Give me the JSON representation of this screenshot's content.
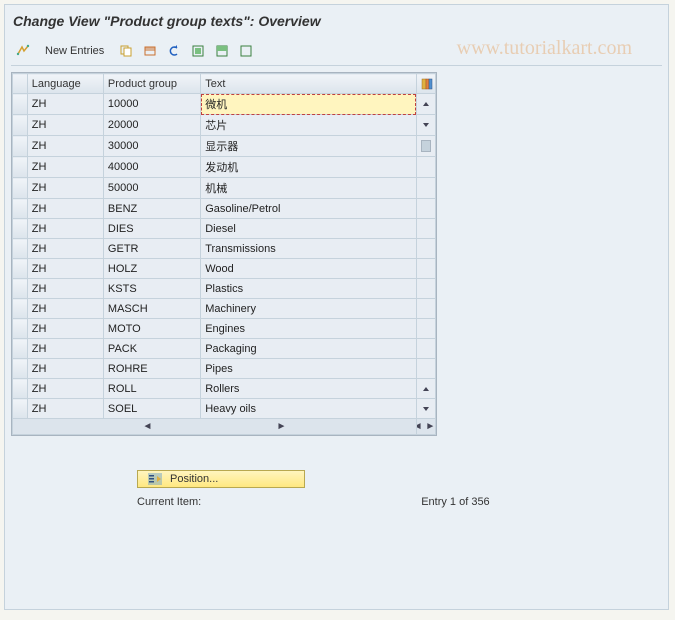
{
  "title": "Change View \"Product group texts\": Overview",
  "toolbar": {
    "new_entries_label": "New Entries"
  },
  "watermark": "www.tutorialkart.com",
  "columns": {
    "language": "Language",
    "product_group": "Product group",
    "text": "Text"
  },
  "rows": [
    {
      "lang": "ZH",
      "pg": "10000",
      "text": "微机",
      "editing": true
    },
    {
      "lang": "ZH",
      "pg": "20000",
      "text": "芯片"
    },
    {
      "lang": "ZH",
      "pg": "30000",
      "text": "显示器"
    },
    {
      "lang": "ZH",
      "pg": "40000",
      "text": "发动机"
    },
    {
      "lang": "ZH",
      "pg": "50000",
      "text": "机械"
    },
    {
      "lang": "ZH",
      "pg": "BENZ",
      "text": "Gasoline/Petrol"
    },
    {
      "lang": "ZH",
      "pg": "DIES",
      "text": "Diesel"
    },
    {
      "lang": "ZH",
      "pg": "GETR",
      "text": "Transmissions"
    },
    {
      "lang": "ZH",
      "pg": "HOLZ",
      "text": "Wood"
    },
    {
      "lang": "ZH",
      "pg": "KSTS",
      "text": "Plastics"
    },
    {
      "lang": "ZH",
      "pg": "MASCH",
      "text": "Machinery"
    },
    {
      "lang": "ZH",
      "pg": "MOTO",
      "text": "Engines"
    },
    {
      "lang": "ZH",
      "pg": "PACK",
      "text": "Packaging"
    },
    {
      "lang": "ZH",
      "pg": "ROHRE",
      "text": "Pipes"
    },
    {
      "lang": "ZH",
      "pg": "ROLL",
      "text": "Rollers"
    },
    {
      "lang": "ZH",
      "pg": "SOEL",
      "text": "Heavy oils"
    }
  ],
  "position_label": "Position...",
  "current_item_label": "Current Item:",
  "entry_status": "Entry 1 of 356"
}
